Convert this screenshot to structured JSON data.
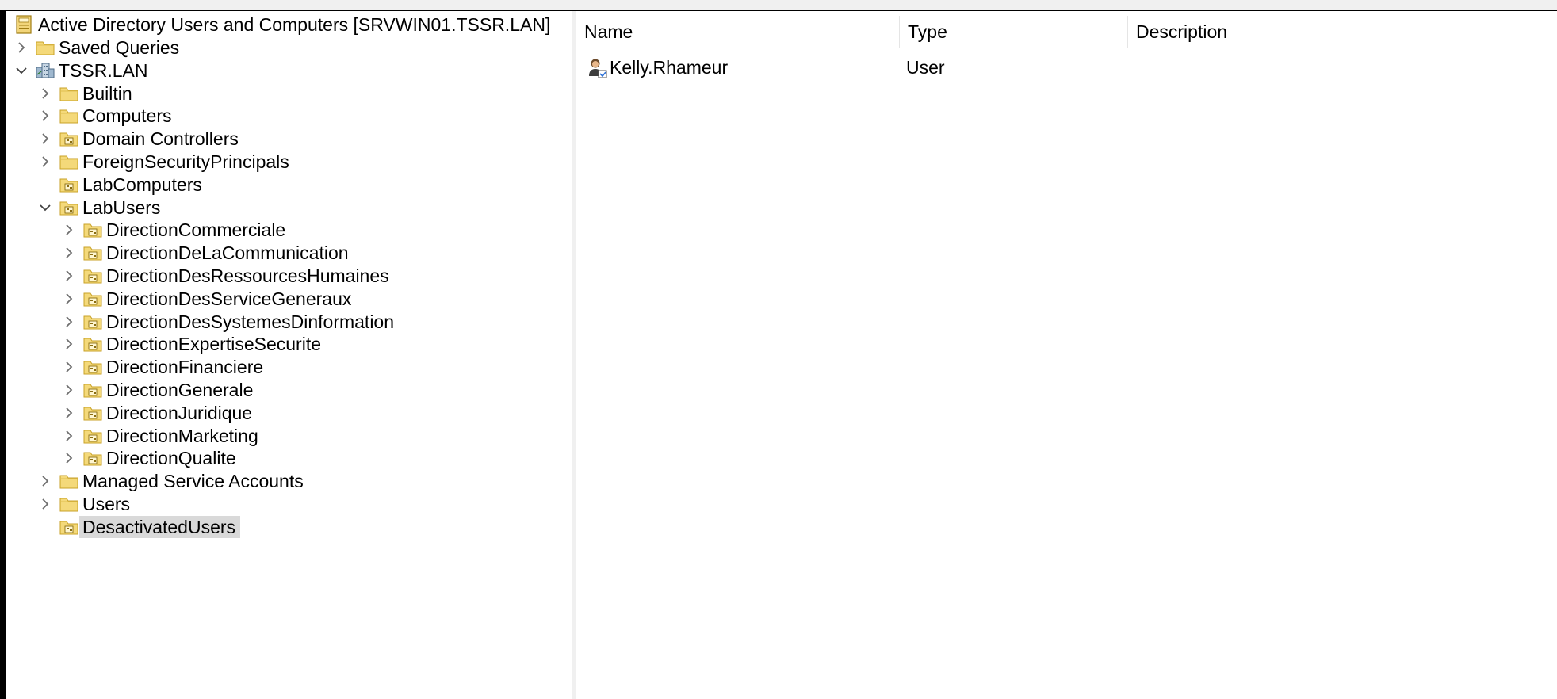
{
  "tree": {
    "root": {
      "label": "Active Directory Users and Computers [SRVWIN01.TSSR.LAN]",
      "icon": "aduc-console-icon"
    },
    "items": [
      {
        "label": "Saved Queries",
        "icon": "folder-icon",
        "expander": "collapsed"
      },
      {
        "label": "TSSR.LAN",
        "icon": "domain-icon",
        "expander": "expanded"
      },
      {
        "label": "Builtin",
        "icon": "folder-icon",
        "expander": "collapsed"
      },
      {
        "label": "Computers",
        "icon": "folder-icon",
        "expander": "collapsed"
      },
      {
        "label": "Domain Controllers",
        "icon": "ou-icon",
        "expander": "collapsed"
      },
      {
        "label": "ForeignSecurityPrincipals",
        "icon": "folder-icon",
        "expander": "collapsed"
      },
      {
        "label": "LabComputers",
        "icon": "ou-icon",
        "expander": "none"
      },
      {
        "label": "LabUsers",
        "icon": "ou-icon",
        "expander": "expanded"
      },
      {
        "label": "DirectionCommerciale",
        "icon": "ou-icon",
        "expander": "collapsed"
      },
      {
        "label": "DirectionDeLaCommunication",
        "icon": "ou-icon",
        "expander": "collapsed"
      },
      {
        "label": "DirectionDesRessourcesHumaines",
        "icon": "ou-icon",
        "expander": "collapsed"
      },
      {
        "label": "DirectionDesServiceGeneraux",
        "icon": "ou-icon",
        "expander": "collapsed"
      },
      {
        "label": "DirectionDesSystemesDinformation",
        "icon": "ou-icon",
        "expander": "collapsed"
      },
      {
        "label": "DirectionExpertiseSecurite",
        "icon": "ou-icon",
        "expander": "collapsed"
      },
      {
        "label": "DirectionFinanciere",
        "icon": "ou-icon",
        "expander": "collapsed"
      },
      {
        "label": "DirectionGenerale",
        "icon": "ou-icon",
        "expander": "collapsed"
      },
      {
        "label": "DirectionJuridique",
        "icon": "ou-icon",
        "expander": "collapsed"
      },
      {
        "label": "DirectionMarketing",
        "icon": "ou-icon",
        "expander": "collapsed"
      },
      {
        "label": "DirectionQualite",
        "icon": "ou-icon",
        "expander": "collapsed"
      },
      {
        "label": "Managed Service Accounts",
        "icon": "folder-icon",
        "expander": "collapsed"
      },
      {
        "label": "Users",
        "icon": "folder-icon",
        "expander": "collapsed"
      },
      {
        "label": "DesactivatedUsers",
        "icon": "ou-icon",
        "expander": "none",
        "selected": true
      }
    ]
  },
  "list": {
    "columns": [
      "Name",
      "Type",
      "Description"
    ],
    "rows": [
      {
        "name": "Kelly.Rhameur",
        "type": "User",
        "description": "",
        "icon": "user-icon"
      }
    ]
  },
  "colors": {
    "selection": "#d9d9d9",
    "folder": "#f4d97a",
    "folder_edge": "#c9a227"
  }
}
